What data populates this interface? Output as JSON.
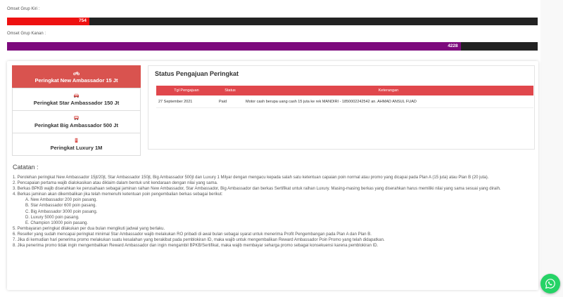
{
  "omset_kiri": {
    "label": "Omset Grup Kiri :",
    "value": "754",
    "fill_fraction": 0.155,
    "color": "#ee1111"
  },
  "omset_kanan": {
    "label": "Omset Grup Kanan :",
    "value": "4228",
    "fill_fraction": 0.855,
    "color": "#7d0a7d"
  },
  "tabs": [
    {
      "label": "Peringkat New Ambassador 15 Jt",
      "icon": "motorcycle-icon",
      "active": true
    },
    {
      "label": "Peringkat Star Ambassador 150 Jt",
      "icon": "car-icon",
      "active": false
    },
    {
      "label": "Peringkat Big Ambassador 500 Jt",
      "icon": "car-icon",
      "active": false
    },
    {
      "label": "Peringkat Luxury 1M",
      "icon": "building-icon",
      "active": false
    }
  ],
  "status": {
    "title": "Status Pengajuan Peringkat",
    "columns": [
      "Tgl Pengajuan",
      "Status",
      "Keterangan"
    ],
    "rows": [
      {
        "tgl": "27 September 2021",
        "status": "Paid",
        "keterangan": "Motor cash berupa uang cash 15 juta ke rek MANDIRI - 1850002242542 an. AHMAD ANSUL FUAD"
      }
    ]
  },
  "catatan": {
    "title": "Catatan :",
    "items": [
      "1. Perolehan peringkat New Ambassador 15jt/20jt, Star Ambassador 150jt, Big Ambassador 500jt dan Luxury 1 Milyar dengan mengacu kepada salah satu ketentuan capaian poin normal atau promo yang dicapai pada Plan A (15 juta) atau Plan B (20 juta).",
      "2. Pencapaian pertama wajib dialokasikan atau diklaim dalam bentuk unit kendaraan dengan nilai yang sama.",
      "3. Berkas BPKB wajib diserahkan ke perusahaan sebagai jaminan raihan New Ambassador, Star Ambassador, Big Ambassador dan berkas Sertifikat untuk raihan Luxury. Masing-masing berkas yang diserahkan harus memiliki nilai yang sama sesuai yang diraih.",
      "4. Berkas jaminan akan dikembalikan jika telah memenuhi ketentuan poin pengembalian berkas sebagai berikut:"
    ],
    "sub_items": [
      "A. New Ambassador 200 poin pasang.",
      "B. Star Ambassador 600 poin pasang.",
      "C. Big Ambassador 3000 poin pasang.",
      "D. Luxury 5000 poin pasang.",
      "E. Champion 10000 poin pasang."
    ],
    "items_after": [
      "5. Pembayaran peringkat dilakukan per dua bulan mengikuti jadwal yang berlaku.",
      "6. Reseller yang sudah mencapai peringkat minimal Star Ambassador wajib melakukan RO pribadi di awal bulan sebagai syarat untuk menerima Profit Pengembangan pada Plan A dan Plan B.",
      "7. Jika di kemudian hari penerima promo melakukan suatu kesalahan yang berakibat pada pemblokiran ID, maka wajib untuk mengembalikan Reward Ambassador Poin Promo yang telah didapatkan.",
      "8. Jika penerima promo tidak ingin mengembalikan Reward Ambassador dan ingin mengambil BPKB/Sertifikat, maka wajib membayar seharga promo sebagai konsekuensi karena pemblokiran ID."
    ]
  },
  "whatsapp": {
    "icon": "whatsapp-icon",
    "color": "#25d366"
  }
}
